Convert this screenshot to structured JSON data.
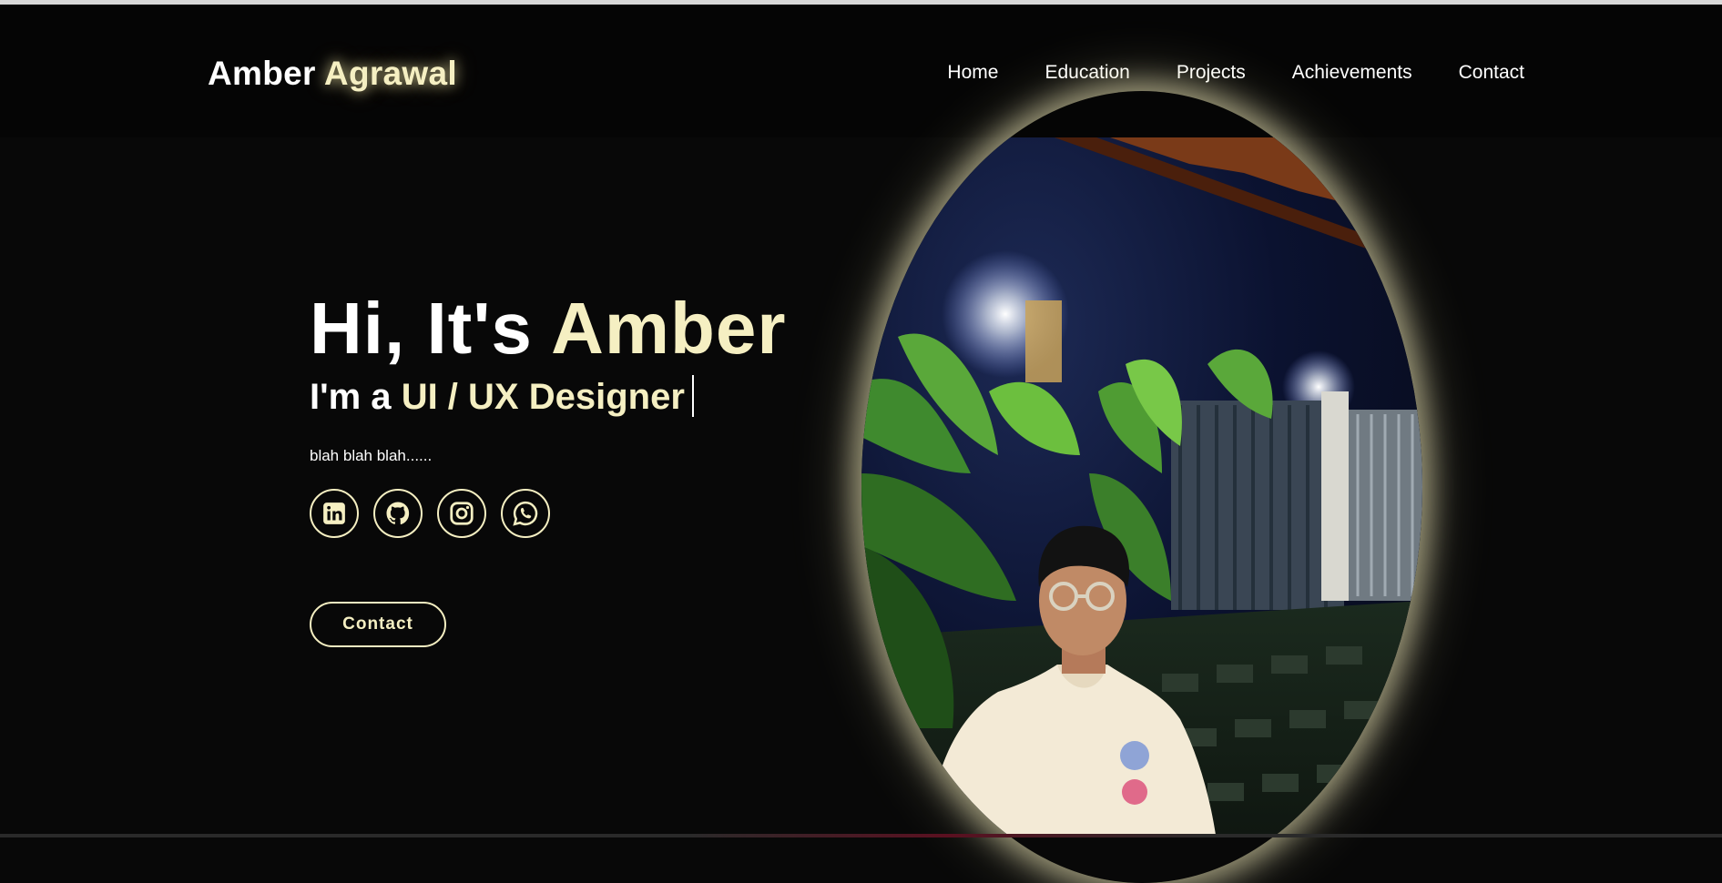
{
  "header": {
    "logo_first": "Amber",
    "logo_last": "Agrawal",
    "nav": [
      "Home",
      "Education",
      "Projects",
      "Achievements",
      "Contact"
    ]
  },
  "hero": {
    "greeting_prefix": "Hi, It's",
    "greeting_name": "Amber",
    "role_prefix": "I'm a",
    "role": "UI / UX Designer",
    "tagline": "blah blah blah......",
    "contact_label": "Contact"
  },
  "socials": [
    {
      "icon": "linkedin-icon"
    },
    {
      "icon": "github-icon"
    },
    {
      "icon": "instagram-icon"
    },
    {
      "icon": "whatsapp-icon"
    }
  ],
  "colors": {
    "accent": "#f5efc2",
    "background": "#080808"
  }
}
